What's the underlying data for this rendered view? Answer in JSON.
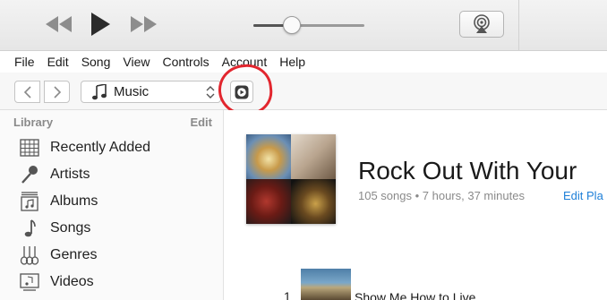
{
  "menu": [
    "File",
    "Edit",
    "Song",
    "View",
    "Controls",
    "Account",
    "Help"
  ],
  "player": {
    "volume_level": 0.35
  },
  "nav": {
    "media_kind": "Music"
  },
  "sidebar": {
    "section_title": "Library",
    "edit_label": "Edit",
    "items": [
      {
        "label": "Recently Added",
        "icon": "recently-added-grid-icon"
      },
      {
        "label": "Artists",
        "icon": "microphone-icon"
      },
      {
        "label": "Albums",
        "icon": "album-icon"
      },
      {
        "label": "Songs",
        "icon": "music-note-icon"
      },
      {
        "label": "Genres",
        "icon": "guitars-icon"
      },
      {
        "label": "Videos",
        "icon": "video-icon"
      }
    ]
  },
  "playlist": {
    "title": "Rock Out With Your",
    "meta": "105 songs • 7 hours, 37 minutes",
    "edit_label": "Edit Pla"
  },
  "tracks": [
    {
      "number": "1",
      "title": "Show Me How to Live"
    }
  ],
  "colors": {
    "accent": "#1e7fd8",
    "highlight_circle": "#e2262e"
  }
}
